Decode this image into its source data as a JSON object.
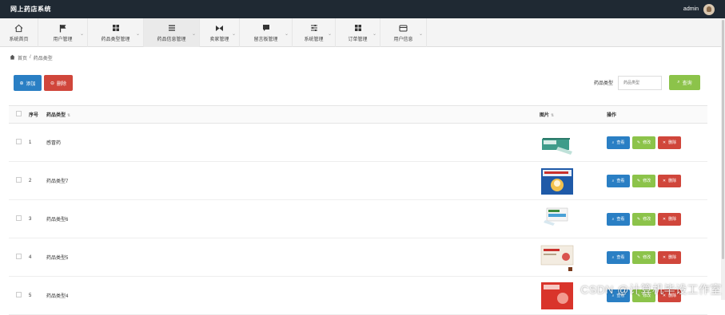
{
  "app": {
    "title": "网上药店系统",
    "user": "admin"
  },
  "nav": [
    {
      "label": "系统首页",
      "icon": "home-icon"
    },
    {
      "label": "用户管理",
      "icon": "flag-icon"
    },
    {
      "label": "药品类型管理",
      "icon": "grid-icon"
    },
    {
      "label": "药品信息管理",
      "icon": "list-icon"
    },
    {
      "label": "卖家管理",
      "icon": "bowtie-icon"
    },
    {
      "label": "留言板管理",
      "icon": "comment-icon"
    },
    {
      "label": "系统管理",
      "icon": "sliders-icon"
    },
    {
      "label": "订单管理",
      "icon": "grid-icon"
    },
    {
      "label": "用户信息",
      "icon": "card-icon"
    }
  ],
  "breadcrumb": {
    "home": "首页",
    "sep": "/",
    "current": "药品类型"
  },
  "toolbar": {
    "add_label": "添加",
    "delete_label": "删除"
  },
  "search": {
    "label": "药品类型",
    "placeholder": "药品类型",
    "button_label": "查询"
  },
  "table": {
    "headers": {
      "no": "序号",
      "name": "药品类型",
      "image": "图片",
      "actions": "操作"
    },
    "rows": [
      {
        "no": "1",
        "name": "感冒药"
      },
      {
        "no": "2",
        "name": "药品类型7"
      },
      {
        "no": "3",
        "name": "药品类型6"
      },
      {
        "no": "4",
        "name": "药品类型5"
      },
      {
        "no": "5",
        "name": "药品类型4"
      }
    ],
    "actions": {
      "view": "查看",
      "edit": "修改",
      "remove": "删除"
    }
  },
  "watermark": "CSDN @计算机毕设工作室"
}
